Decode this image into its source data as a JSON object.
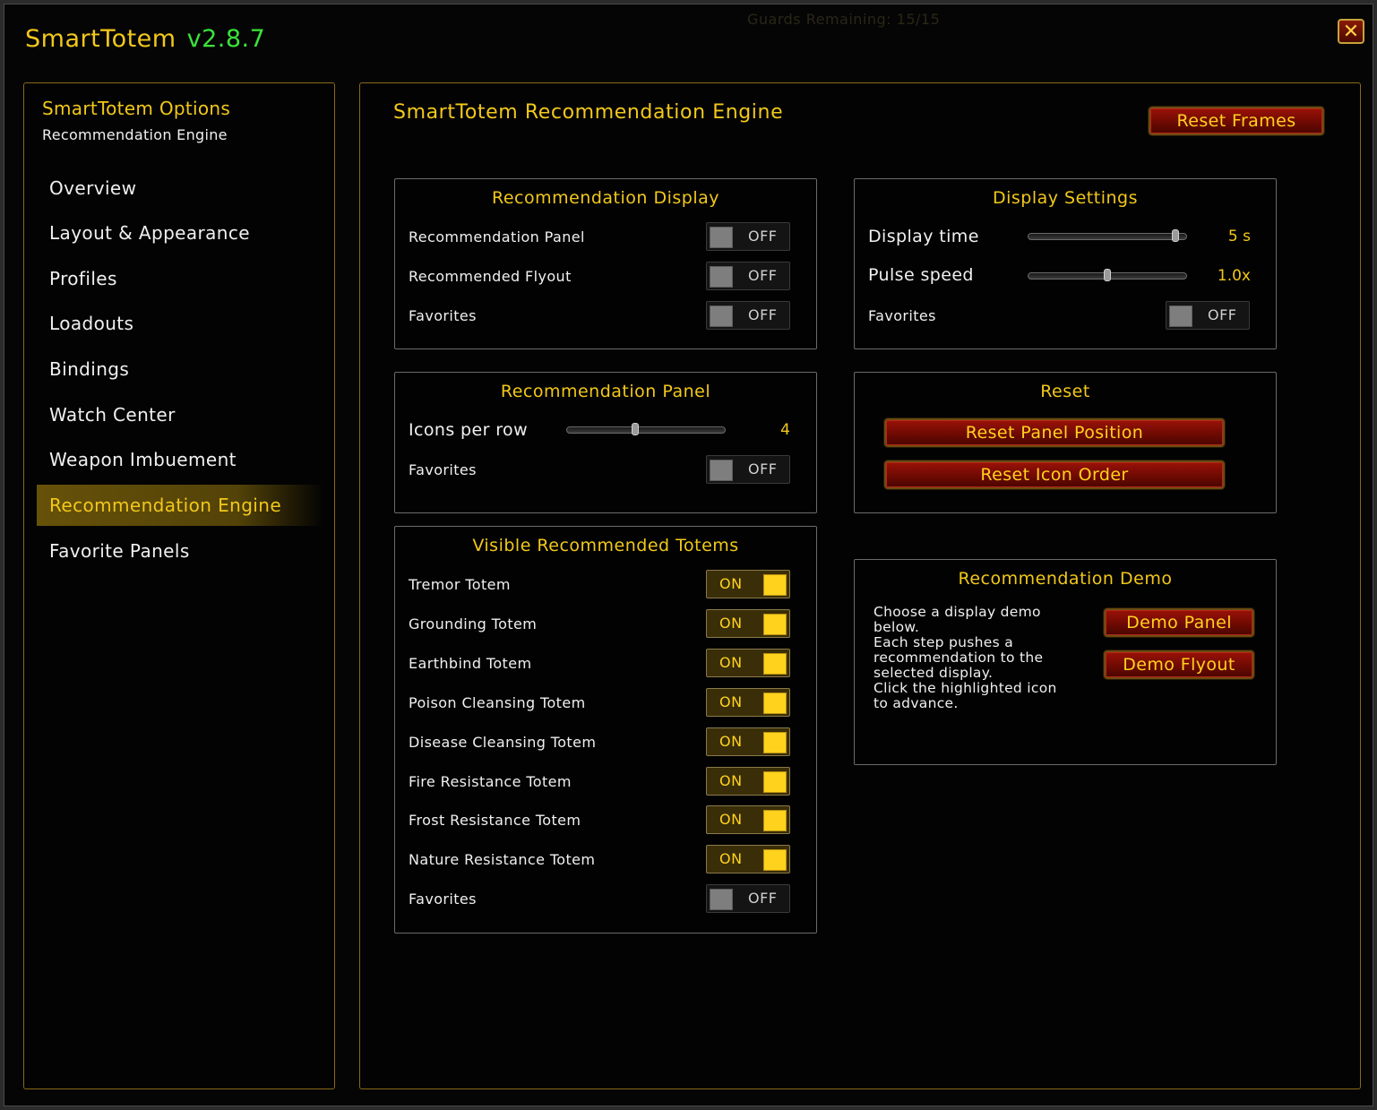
{
  "background_hint": "Guards Remaining: 15/15",
  "window": {
    "title": "SmartTotem",
    "version": "v2.8.7",
    "close_glyph": "✕"
  },
  "sidebar": {
    "heading": "SmartTotem Options",
    "subheading": "Recommendation Engine",
    "items": [
      {
        "label": "Overview",
        "active": false
      },
      {
        "label": "Layout & Appearance",
        "active": false
      },
      {
        "label": "Profiles",
        "active": false
      },
      {
        "label": "Loadouts",
        "active": false
      },
      {
        "label": "Bindings",
        "active": false
      },
      {
        "label": "Watch Center",
        "active": false
      },
      {
        "label": "Weapon Imbuement",
        "active": false
      },
      {
        "label": "Recommendation Engine",
        "active": true
      },
      {
        "label": "Favorite Panels",
        "active": false
      }
    ]
  },
  "main": {
    "title": "SmartTotem  Recommendation Engine",
    "reset_frames_label": "Reset Frames",
    "recommendation_display": {
      "title": "Recommendation Display",
      "rows": [
        {
          "label": "Recommendation Panel",
          "state": "OFF"
        },
        {
          "label": "Recommended Flyout",
          "state": "OFF"
        },
        {
          "label": "Favorites",
          "state": "OFF"
        }
      ]
    },
    "display_settings": {
      "title": "Display Settings",
      "display_time": {
        "label": "Display time",
        "value_text": "5 s",
        "level": 0.95
      },
      "pulse_speed": {
        "label": "Pulse speed",
        "value_text": "1.0x",
        "level": 0.5
      },
      "favorites": {
        "label": "Favorites",
        "state": "OFF"
      }
    },
    "recommendation_panel": {
      "title": "Recommendation Panel",
      "icons_per_row": {
        "label": "Icons per row",
        "value_text": "4",
        "level": 0.43
      },
      "favorites": {
        "label": "Favorites",
        "state": "OFF"
      }
    },
    "reset": {
      "title": "Reset",
      "reset_panel_position_label": "Reset Panel Position",
      "reset_icon_order_label": "Reset Icon Order"
    },
    "visible_totems": {
      "title": "Visible Recommended Totems",
      "rows": [
        {
          "label": "Tremor Totem",
          "state": "ON"
        },
        {
          "label": "Grounding Totem",
          "state": "ON"
        },
        {
          "label": "Earthbind Totem",
          "state": "ON"
        },
        {
          "label": "Poison Cleansing Totem",
          "state": "ON"
        },
        {
          "label": "Disease Cleansing Totem",
          "state": "ON"
        },
        {
          "label": "Fire Resistance Totem",
          "state": "ON"
        },
        {
          "label": "Frost Resistance Totem",
          "state": "ON"
        },
        {
          "label": "Nature Resistance Totem",
          "state": "ON"
        },
        {
          "label": "Favorites",
          "state": "OFF"
        }
      ]
    },
    "recommendation_demo": {
      "title": "Recommendation Demo",
      "description_lines": [
        "Choose a display demo",
        "below.",
        "Each step pushes a",
        "recommendation to the",
        "selected display.",
        "Click the highlighted icon",
        "to advance."
      ],
      "demo_panel_label": "Demo Panel",
      "demo_flyout_label": "Demo Flyout"
    }
  }
}
